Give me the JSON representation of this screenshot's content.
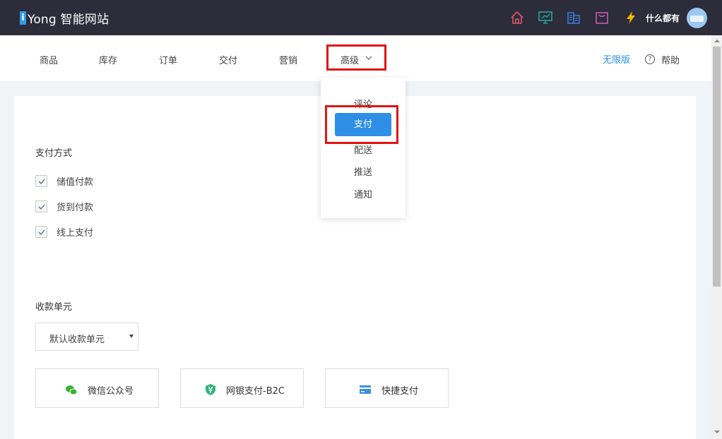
{
  "header": {
    "logo_mark": "i",
    "logo_text": "Yong 智能网站",
    "user_name": "什么都有",
    "icons": [
      "home-icon",
      "monitor-icon",
      "building-icon",
      "bag-icon",
      "lightning-icon"
    ],
    "colors": {
      "bar": "#2c2c3a",
      "home": "#e0566b",
      "monitor": "#25a79a",
      "building": "#3b7bd4",
      "bag": "#c25ab8",
      "lightning": "#f5b800"
    }
  },
  "nav": {
    "items": [
      "商品",
      "库存",
      "订单",
      "交付",
      "营销"
    ],
    "advanced_label": "高级",
    "unlimited_label": "无限版",
    "help_icon_glyph": "?",
    "help_label": "帮助"
  },
  "dropdown": {
    "items": [
      "评论",
      "支付",
      "配送",
      "推送",
      "通知"
    ],
    "active_index": 1,
    "accent": "#2f8fe6"
  },
  "payment_methods": {
    "title": "支付方式",
    "options": [
      {
        "label": "储值付款",
        "checked": true
      },
      {
        "label": "货到付款",
        "checked": true
      },
      {
        "label": "线上支付",
        "checked": true
      }
    ]
  },
  "collection_unit": {
    "title": "收款单元",
    "select_value": "默认收款单元"
  },
  "channels": [
    {
      "label": "微信公众号",
      "icon": "wechat-icon",
      "color": "#3cb034"
    },
    {
      "label": "网银支付-B2C",
      "icon": "shield-yen-icon",
      "color": "#2fb57a"
    },
    {
      "label": "快捷支付",
      "icon": "card-icon",
      "color": "#3b8fe0"
    }
  ],
  "highlight_color": "#e01515"
}
